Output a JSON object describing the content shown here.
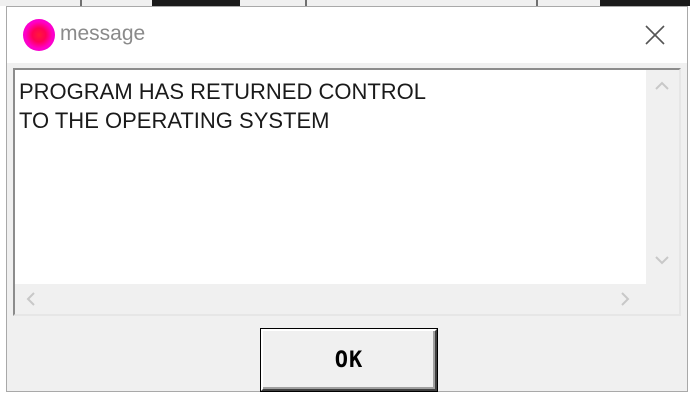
{
  "dialog": {
    "title": "message",
    "close_icon": "close-icon",
    "app_icon": "magenta-circle-icon",
    "message_lines": "PROGRAM HAS RETURNED CONTROL\nTO THE OPERATING SYSTEM",
    "ok_label": "OK"
  },
  "colors": {
    "title_text": "#8a8a8a",
    "dialog_bg": "#f0f0f0",
    "icon_gradient": [
      "#ff1a3a",
      "#ff00c8"
    ]
  }
}
